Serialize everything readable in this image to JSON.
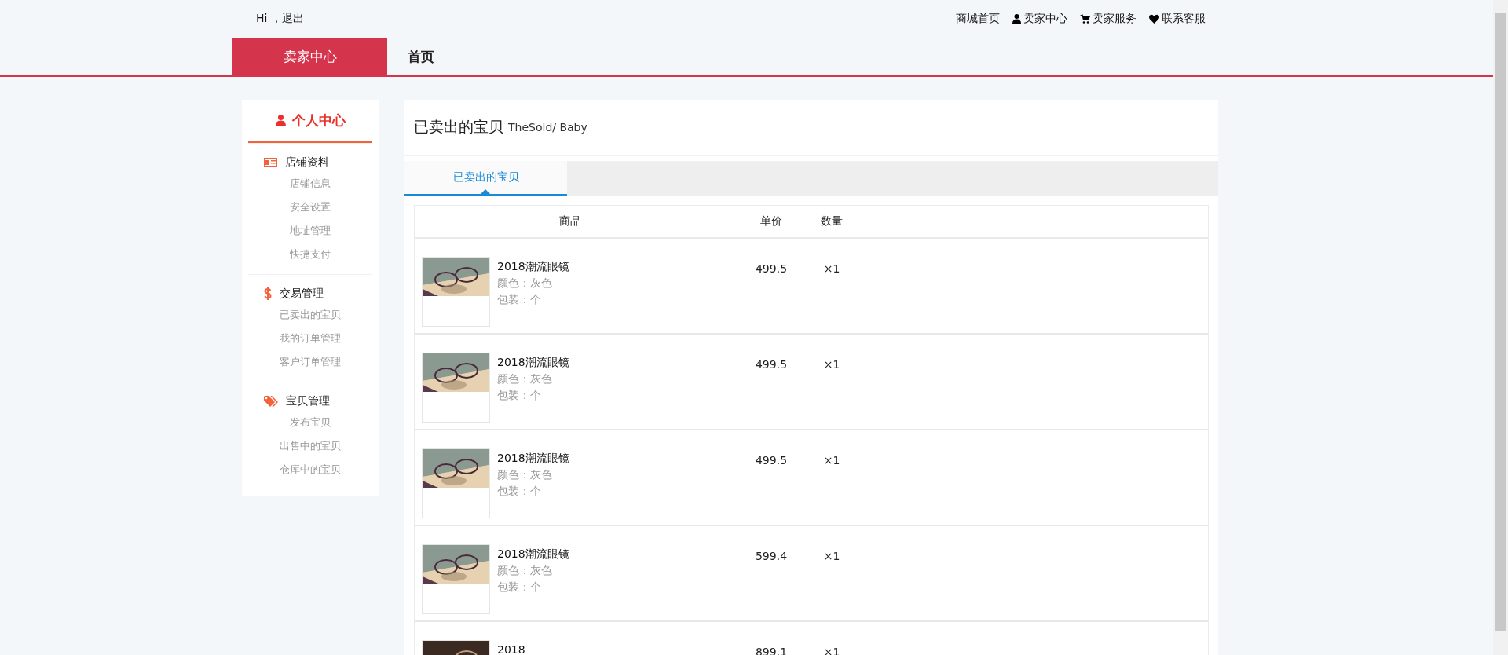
{
  "top_bar": {
    "greeting": "Hi ，退出",
    "links": [
      {
        "label": "商城首页"
      },
      {
        "label": "卖家中心"
      },
      {
        "label": "卖家服务"
      },
      {
        "label": "联系客服"
      }
    ]
  },
  "nav": {
    "tabs": [
      {
        "label": "卖家中心",
        "selected": true
      },
      {
        "label": "首页",
        "selected": false
      }
    ]
  },
  "sidebar": {
    "title": "个人中心",
    "groups": [
      {
        "label": "店铺资料",
        "items": [
          "店铺信息",
          "安全设置",
          "地址管理",
          "快捷支付"
        ]
      },
      {
        "label": "交易管理",
        "items": [
          "已卖出的宝贝",
          "我的订单管理",
          "客户订单管理"
        ]
      },
      {
        "label": "宝贝管理",
        "items": [
          "发布宝贝",
          "出售中的宝贝",
          "仓库中的宝贝"
        ]
      }
    ]
  },
  "main": {
    "title": "已卖出的宝贝",
    "subtitle": "TheSold/ Baby",
    "tabs": [
      {
        "label": "已卖出的宝贝",
        "selected": true
      }
    ],
    "table": {
      "columns": [
        "商品",
        "单价",
        "数量"
      ],
      "rows": [
        {
          "name": "2018潮流眼镜",
          "color_line": "颜色：灰色",
          "package_line": "包装：个",
          "price": "499.5",
          "quantity": "×1"
        },
        {
          "name": "2018潮流眼镜",
          "color_line": "颜色：灰色",
          "package_line": "包装：个",
          "price": "499.5",
          "quantity": "×1"
        },
        {
          "name": "2018潮流眼镜",
          "color_line": "颜色：灰色",
          "package_line": "包装：个",
          "price": "499.5",
          "quantity": "×1"
        },
        {
          "name": "2018潮流眼镜",
          "color_line": "颜色：灰色",
          "package_line": "包装：个",
          "price": "599.4",
          "quantity": "×1"
        },
        {
          "name": "2018",
          "price": "899.1",
          "quantity": "×1"
        }
      ]
    }
  }
}
